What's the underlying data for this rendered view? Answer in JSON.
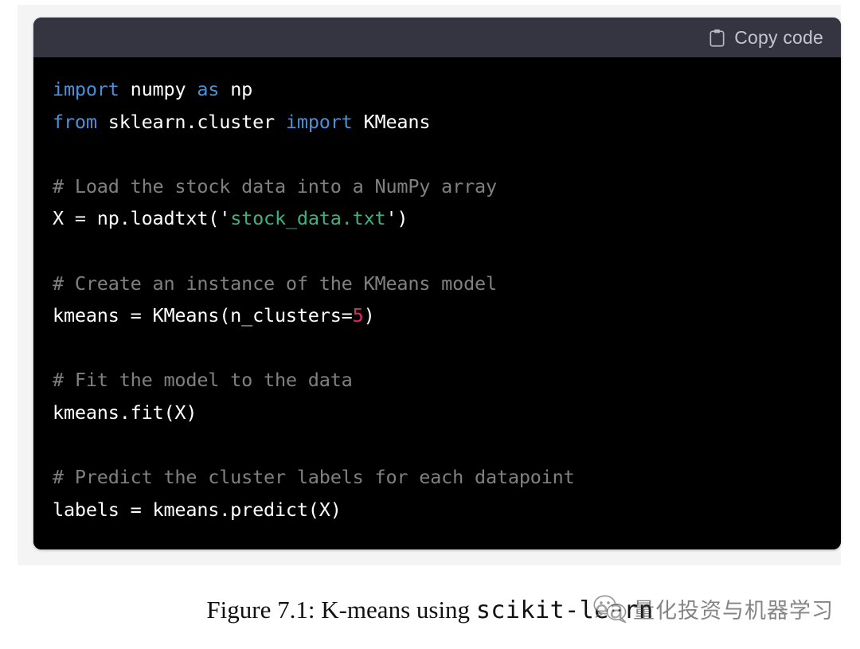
{
  "code_block": {
    "header": {
      "copy_label": "Copy code",
      "icon": "clipboard-icon"
    },
    "language": "python",
    "lines": [
      [
        {
          "t": "import",
          "c": "kw"
        },
        {
          "t": " numpy ",
          "c": "name"
        },
        {
          "t": "as",
          "c": "kw"
        },
        {
          "t": " np",
          "c": "name"
        }
      ],
      [
        {
          "t": "from",
          "c": "kw"
        },
        {
          "t": " sklearn.cluster ",
          "c": "name"
        },
        {
          "t": "import",
          "c": "kw"
        },
        {
          "t": " KMeans",
          "c": "name"
        }
      ],
      [],
      [
        {
          "t": "# Load the stock data into a NumPy array",
          "c": "com"
        }
      ],
      [
        {
          "t": "X = np.loadtxt(",
          "c": "name"
        },
        {
          "t": "'",
          "c": "pun"
        },
        {
          "t": "stock_data.txt",
          "c": "str"
        },
        {
          "t": "'",
          "c": "pun"
        },
        {
          "t": ")",
          "c": "name"
        }
      ],
      [],
      [
        {
          "t": "# Create an instance of the KMeans model",
          "c": "com"
        }
      ],
      [
        {
          "t": "kmeans = KMeans(n_clusters=",
          "c": "name"
        },
        {
          "t": "5",
          "c": "num"
        },
        {
          "t": ")",
          "c": "name"
        }
      ],
      [],
      [
        {
          "t": "# Fit the model to the data",
          "c": "com"
        }
      ],
      [
        {
          "t": "kmeans.fit(X)",
          "c": "name"
        }
      ],
      [],
      [
        {
          "t": "# Predict the cluster labels for each datapoint",
          "c": "com"
        }
      ],
      [
        {
          "t": "labels = kmeans.predict(X)",
          "c": "name"
        }
      ]
    ],
    "plain_text": "import numpy as np\nfrom sklearn.cluster import KMeans\n\n# Load the stock data into a NumPy array\nX = np.loadtxt('stock_data.txt')\n\n# Create an instance of the KMeans model\nkmeans = KMeans(n_clusters=5)\n\n# Fit the model to the data\nkmeans.fit(X)\n\n# Predict the cluster labels for each datapoint\nlabels = kmeans.predict(X)"
  },
  "caption": {
    "prefix": "Figure 7.1: K-means using ",
    "mono": "scikit-learn"
  },
  "watermark": {
    "icon": "wechat-icon",
    "text": "量化投资与机器学习"
  },
  "colors": {
    "header_bg": "#343541",
    "code_bg": "#000000",
    "page_band": "#f4f4f5",
    "keyword": "#4b8fd6",
    "comment": "#808080",
    "string": "#3fb27f",
    "number": "#d92b6d",
    "foreground": "#ffffff",
    "copy_label": "#c5c5d2"
  }
}
